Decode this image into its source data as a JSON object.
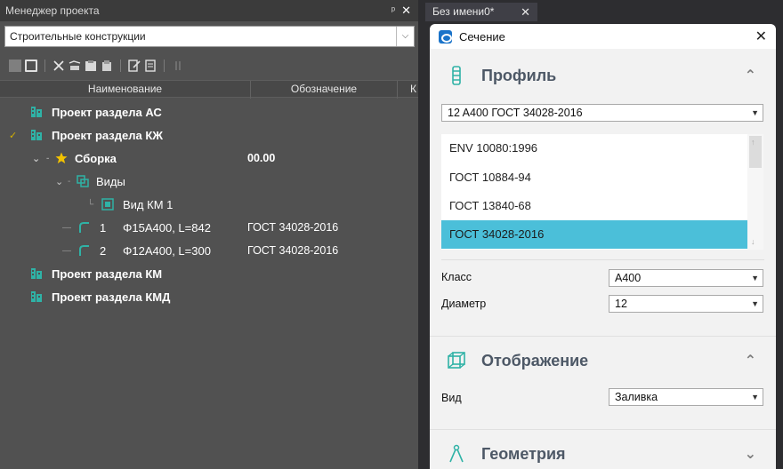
{
  "project_manager": {
    "title": "Менеджер проекта",
    "pin_glyph": "ᵖ",
    "close_glyph": "✕",
    "filter_value": "Строительные конструкции",
    "columns": [
      "Наименование",
      "Обозначение",
      "К"
    ],
    "tree": [
      {
        "label": "Проект раздела АС",
        "code": ""
      },
      {
        "label": "Проект раздела КЖ",
        "code": ""
      },
      {
        "label": "Сборка",
        "code": "00.00"
      },
      {
        "label": "Виды",
        "code": ""
      },
      {
        "label": "Вид КМ 1",
        "code": ""
      },
      {
        "label": "1",
        "sub": "Φ15A400, L=842",
        "code": "ГОСТ 34028-2016"
      },
      {
        "label": "2",
        "sub": "Φ12A400, L=300",
        "code": "ГОСТ 34028-2016"
      },
      {
        "label": "Проект раздела КМ",
        "code": ""
      },
      {
        "label": "Проект раздела КМД",
        "code": ""
      }
    ]
  },
  "tabbar": {
    "tab_label": "Без имени0*",
    "close_glyph": "✕"
  },
  "section_panel": {
    "title": "Сечение",
    "close_glyph": "✕",
    "profile": {
      "heading": "Профиль",
      "selected": "12 A400 ГОСТ 34028-2016",
      "standards": [
        "ENV 10080:1996",
        "ГОСТ 10884-94",
        "ГОСТ 13840-68",
        "ГОСТ 34028-2016"
      ],
      "selected_index": 3,
      "class_label": "Класс",
      "class_value": "A400",
      "diameter_label": "Диаметр",
      "diameter_value": "12"
    },
    "display": {
      "heading": "Отображение",
      "view_label": "Вид",
      "view_value": "Заливка"
    },
    "geometry": {
      "heading": "Геометрия"
    }
  },
  "colors": {
    "accent": "#4bbfd9",
    "tree_icon": "#2fb2a6",
    "star": "#f2c200",
    "group_heading": "#4d5866"
  }
}
